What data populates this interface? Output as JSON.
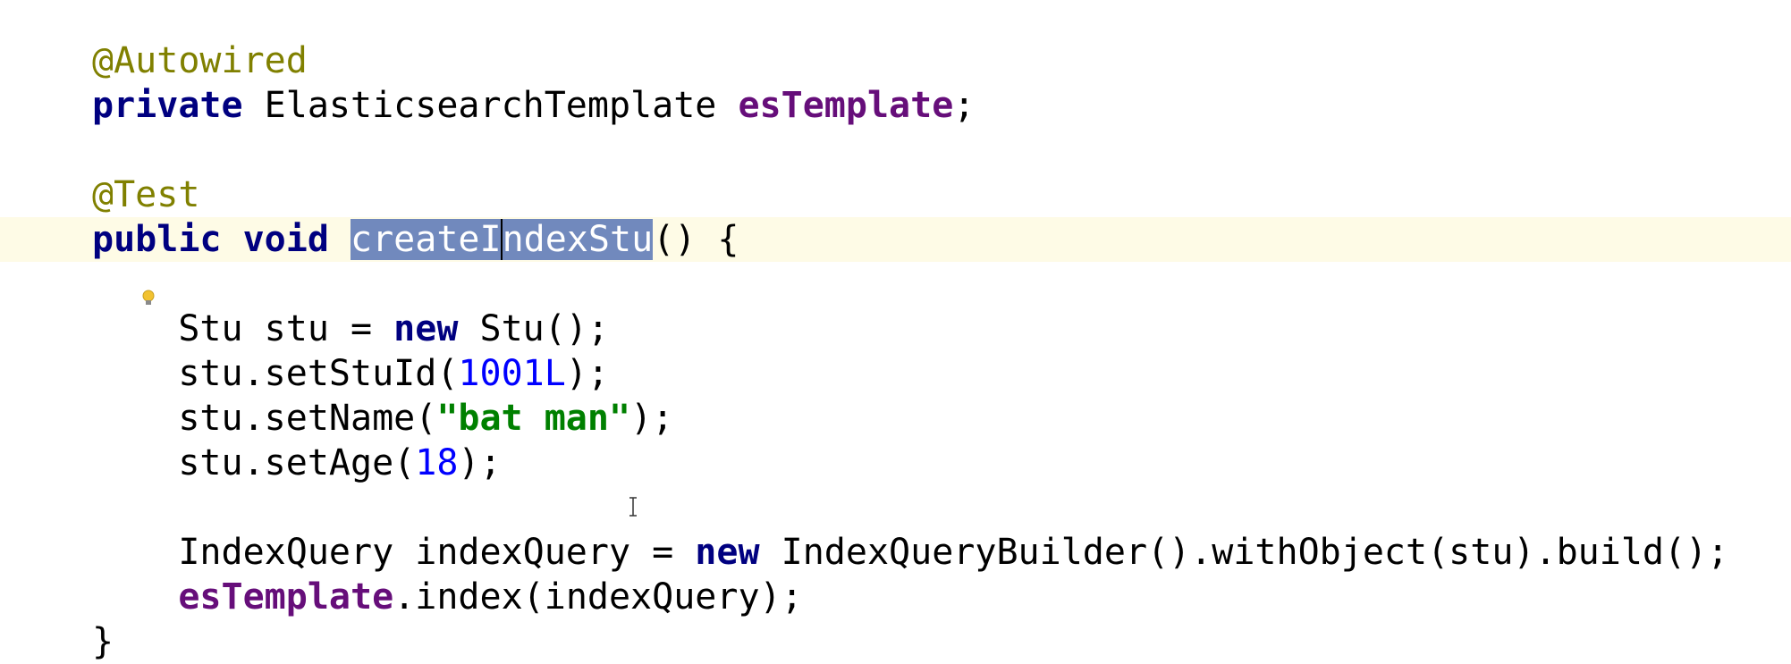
{
  "editor": {
    "lines": [
      {
        "id": "l1",
        "parts": [
          {
            "t": "@Autowired",
            "c": "ann"
          }
        ]
      },
      {
        "id": "l2",
        "parts": [
          {
            "t": "private",
            "c": "kw"
          },
          {
            "t": " ElasticsearchTemplate ",
            "c": ""
          },
          {
            "t": "esTemplate",
            "c": "field"
          },
          {
            "t": ";",
            "c": ""
          }
        ]
      },
      {
        "id": "l3",
        "parts": []
      },
      {
        "id": "l4",
        "parts": [
          {
            "t": "@Test",
            "c": "ann"
          }
        ]
      },
      {
        "id": "l5",
        "parts": [
          {
            "t": "public",
            "c": "kw"
          },
          {
            "t": " ",
            "c": ""
          },
          {
            "t": "void",
            "c": "kw"
          },
          {
            "t": " ",
            "c": ""
          },
          {
            "t": "createI",
            "c": "sel"
          },
          {
            "t": "ndexStu",
            "c": "sel caret-in-sel"
          },
          {
            "t": "() {",
            "c": ""
          }
        ]
      },
      {
        "id": "l6",
        "parts": []
      },
      {
        "id": "l7",
        "parts": [
          {
            "t": "    Stu stu = ",
            "c": ""
          },
          {
            "t": "new",
            "c": "kw"
          },
          {
            "t": " Stu();",
            "c": ""
          }
        ]
      },
      {
        "id": "l8",
        "parts": [
          {
            "t": "    stu.setStuId(",
            "c": ""
          },
          {
            "t": "1001L",
            "c": "num"
          },
          {
            "t": ");",
            "c": ""
          }
        ]
      },
      {
        "id": "l9",
        "parts": [
          {
            "t": "    stu.setName(",
            "c": ""
          },
          {
            "t": "\"bat man\"",
            "c": "str"
          },
          {
            "t": ");",
            "c": ""
          }
        ]
      },
      {
        "id": "l10",
        "parts": [
          {
            "t": "    stu.setAge(",
            "c": ""
          },
          {
            "t": "18",
            "c": "num"
          },
          {
            "t": ");",
            "c": ""
          }
        ]
      },
      {
        "id": "l11",
        "parts": []
      },
      {
        "id": "l12",
        "parts": [
          {
            "t": "    IndexQuery indexQuery = ",
            "c": ""
          },
          {
            "t": "new",
            "c": "kw"
          },
          {
            "t": " IndexQueryBuilder().withObject(stu).build();",
            "c": ""
          }
        ]
      },
      {
        "id": "l13",
        "parts": [
          {
            "t": "    ",
            "c": ""
          },
          {
            "t": "esTemplate",
            "c": "field"
          },
          {
            "t": ".index(indexQuery);",
            "c": ""
          }
        ]
      },
      {
        "id": "l14",
        "parts": [
          {
            "t": "}",
            "c": ""
          }
        ]
      }
    ],
    "current_line_id": "l5",
    "selected_text": "createIndexStu",
    "icons": {
      "intention": "lightbulb-icon",
      "cursor": "text-cursor-icon"
    },
    "colors": {
      "keyword": "#000080",
      "annotation": "#808000",
      "field": "#660e7a",
      "number": "#0000ff",
      "string": "#008000",
      "selection": "#7189bd",
      "current_line": "#fefbe6"
    }
  }
}
